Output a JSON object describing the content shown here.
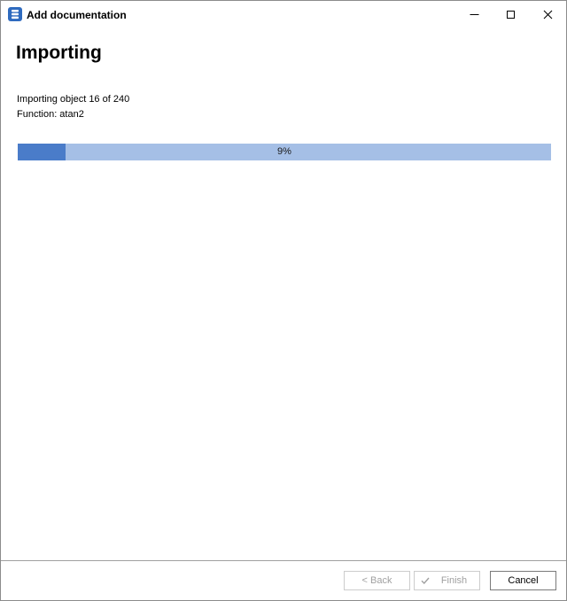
{
  "window": {
    "title": "Add documentation",
    "app_icon": "document-stack-icon",
    "controls": [
      "minimize-icon",
      "maximize-icon",
      "close-icon"
    ]
  },
  "page": {
    "heading": "Importing",
    "status_object": "Importing object 16 of 240",
    "status_function": "Function: atan2"
  },
  "progress": {
    "value_percent": 9,
    "label": "9%"
  },
  "footer": {
    "back_label": "< Back",
    "finish_label": "Finish",
    "cancel_label": "Cancel",
    "back_enabled": false,
    "finish_enabled": false,
    "cancel_enabled": true
  },
  "colors": {
    "progress_fill": "#4a7cc9",
    "progress_track": "#a5bfe6",
    "app_icon": "#2f6bbf"
  }
}
